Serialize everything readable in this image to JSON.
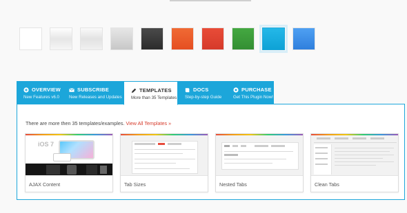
{
  "swatches": [
    {
      "name": "white",
      "color": "#ffffff"
    },
    {
      "name": "light-gray",
      "color": "#f2f2f2"
    },
    {
      "name": "silver",
      "color": "#ebebeb"
    },
    {
      "name": "gray",
      "color": "#d4d4d4"
    },
    {
      "name": "black",
      "color": "#3a3a3a"
    },
    {
      "name": "orange",
      "color": "#ec5a2a"
    },
    {
      "name": "red",
      "color": "#e1402f"
    },
    {
      "name": "green",
      "color": "#3c9b3a"
    },
    {
      "name": "cyan",
      "color": "#16aee0",
      "selected": true
    },
    {
      "name": "blue",
      "color": "#3a8ee8"
    }
  ],
  "tabs": [
    {
      "title": "OVERVIEW",
      "sub": "New Features v6.0",
      "icon": "plus-circle-icon"
    },
    {
      "title": "SUBSCRIBE",
      "sub": "New Releases and Updates",
      "icon": "envelope-icon"
    },
    {
      "title": "TEMPLATES",
      "sub": "More than 35 Templates",
      "icon": "pencil-icon",
      "active": true
    },
    {
      "title": "DOCS",
      "sub": "Step-by-step Guide",
      "icon": "book-icon"
    },
    {
      "title": "PURCHASE",
      "sub": "Get This Plugin Now!",
      "icon": "circle-arrow-icon"
    }
  ],
  "panel": {
    "intro": "There are more then 35 templates/examples.",
    "link": "View All Templates »"
  },
  "cards": [
    {
      "label": "AJAX Content",
      "thumb_text": "iOS 7"
    },
    {
      "label": "Tab Sizes"
    },
    {
      "label": "Nested Tabs"
    },
    {
      "label": "Clean Tabs"
    }
  ],
  "colors": {
    "accent": "#1ca6da",
    "link": "#d63b2b"
  }
}
